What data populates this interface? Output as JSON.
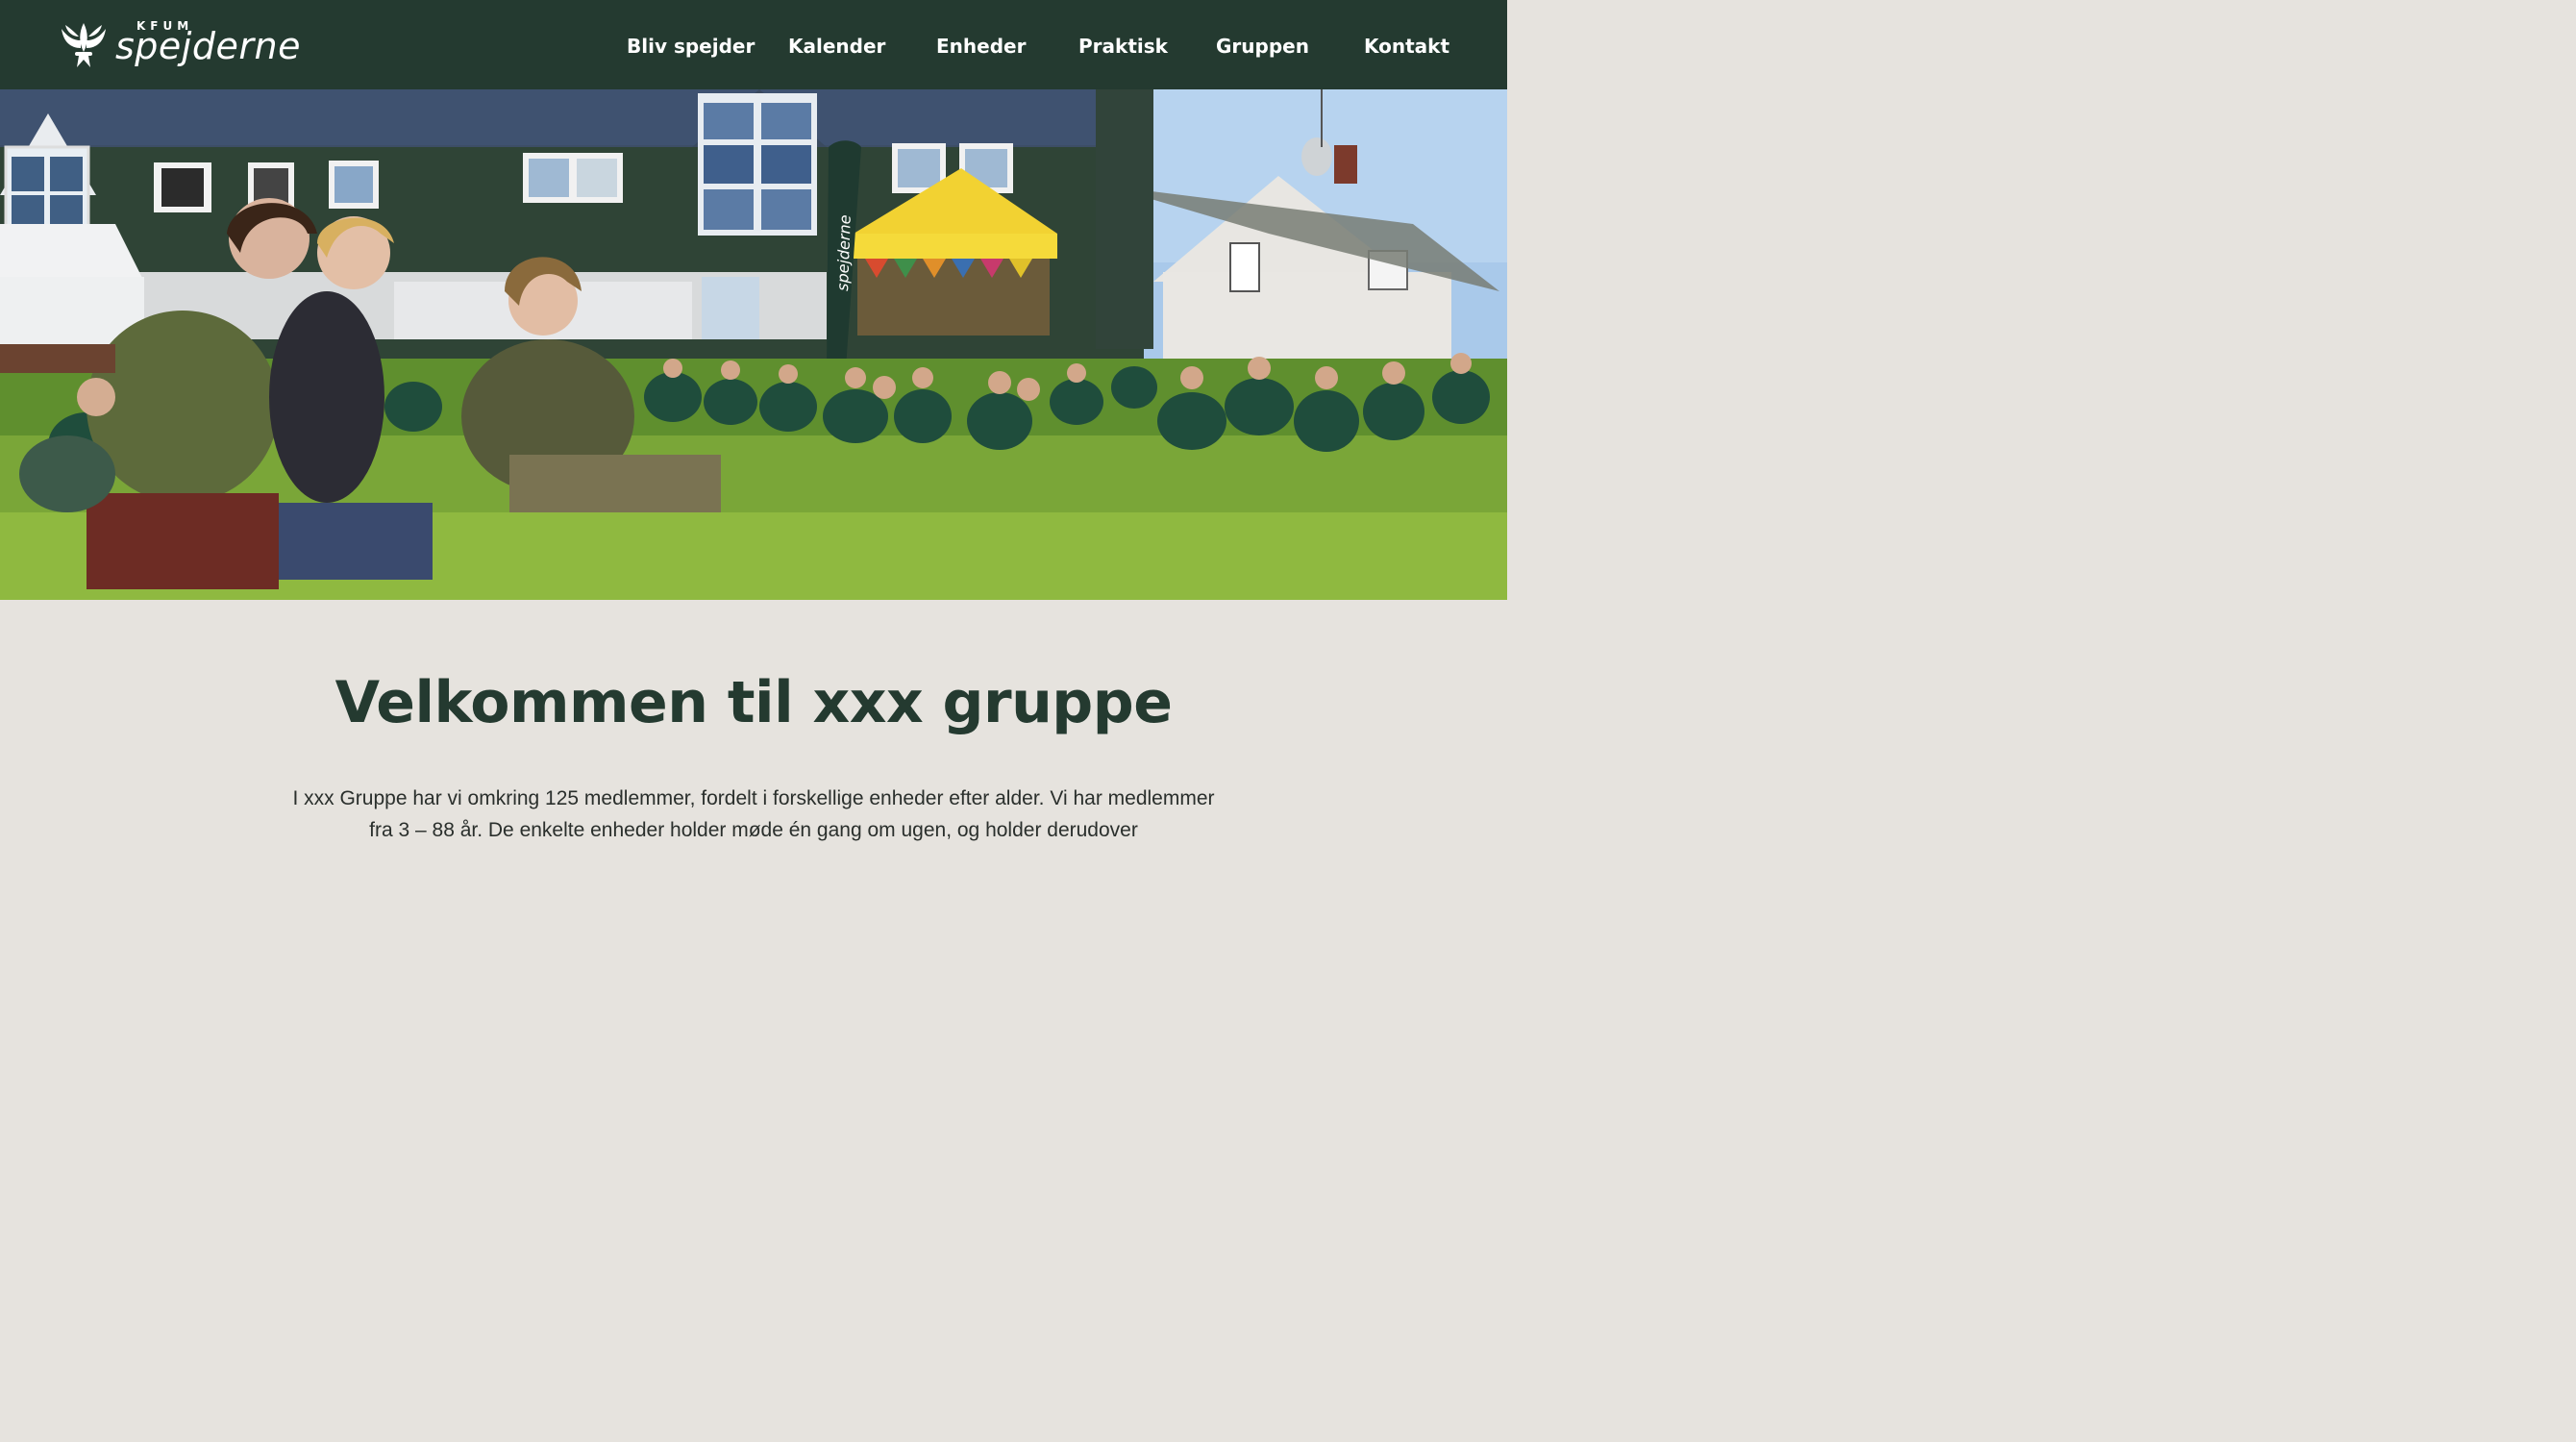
{
  "header": {
    "logo_small": "KFUM",
    "logo_word": "spejderne",
    "nav": [
      "Bliv spejder",
      "Kalender",
      "Enheder",
      "Praktisk",
      "Gruppen",
      "Kontakt"
    ]
  },
  "hero": {
    "banner_text": "spejderne"
  },
  "main": {
    "title": "Velkommen til xxx gruppe",
    "intro": "I xxx Gruppe har vi omkring 125 medlemmer, fordelt i forskellige enheder efter alder. Vi har medlemmer fra 3 – 88 år. De enkelte enheder holder møde én gang om ugen, og holder derudover"
  },
  "colors": {
    "header_bg": "#243a30",
    "content_bg": "#e6e3de",
    "heading": "#243a30"
  }
}
